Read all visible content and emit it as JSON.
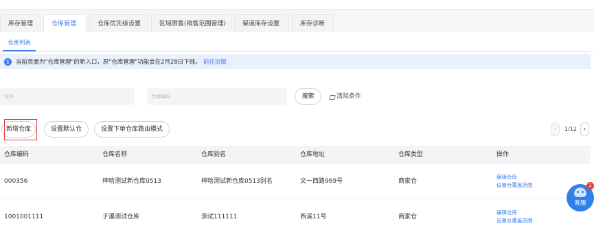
{
  "tabs": [
    {
      "label": "库存管理"
    },
    {
      "label": "仓库管理"
    },
    {
      "label": "仓库优先级设置"
    },
    {
      "label": "区域限售(销售范围管理)"
    },
    {
      "label": "渠道库存设置"
    },
    {
      "label": "库存诊断"
    }
  ],
  "subtab": {
    "label": "仓库列表"
  },
  "notice": {
    "text": "当前页面为\"仓库管理\"的新入口，原\"仓库管理\"功能会在2月28日下线。",
    "link": "前往旧版"
  },
  "filters": {
    "name_placeholder": "名称",
    "code_placeholder": "仓库编码",
    "search_label": "搜索",
    "clear_label": "清除条件"
  },
  "actions": {
    "add": "新增仓库",
    "set_default": "设置默认仓",
    "set_routing": "设置下单仓库路由模式"
  },
  "pager": {
    "text": "1/12"
  },
  "table": {
    "headers": [
      "仓库编码",
      "仓库名称",
      "仓库别名",
      "仓库地址",
      "仓库类型",
      "操作"
    ],
    "rows": [
      {
        "code": "000356",
        "name": "梓晗测试新仓库0513",
        "alias": "梓晗测试新仓库0513别名",
        "address": "文一西路969号",
        "type": "商家仓",
        "op1": "编辑仓库",
        "op2": "设置仓覆盖范围"
      },
      {
        "code": "1001001111",
        "name": "子瀑测试仓库",
        "alias": "测试111111",
        "address": "西溪11号",
        "type": "商家仓",
        "op1": "编辑仓库",
        "op2": "设置仓覆盖范围"
      }
    ]
  },
  "support": {
    "label": "客服",
    "badge": "1"
  },
  "colors": {
    "accent": "#3a7bf0",
    "highlight_box": "#e53935",
    "badge": "#f23a3a"
  }
}
